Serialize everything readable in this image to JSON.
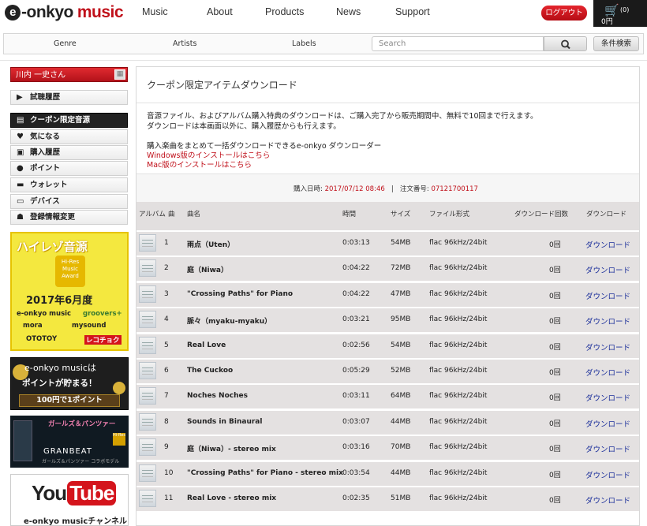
{
  "header": {
    "logo_prefix": "e",
    "logo_onkyo": "-onkyo",
    "logo_music": "music",
    "nav": [
      "Music",
      "About",
      "Products",
      "News",
      "Support"
    ],
    "logout_label": "ログアウト",
    "cart_count": "(0)",
    "cart_total": "0円"
  },
  "searchbar": {
    "links": [
      "Genre",
      "Artists",
      "Labels"
    ],
    "placeholder": "Search",
    "advanced_label": "条件検索"
  },
  "sidebar": {
    "user_name": "川内 一史さん",
    "menu": [
      {
        "label": "試聴履歴",
        "icon": "play-icon",
        "active": false
      },
      {
        "label": "クーポン限定音源",
        "icon": "coupon-icon",
        "active": true
      },
      {
        "label": "気になる",
        "icon": "heart-icon",
        "active": false
      },
      {
        "label": "購入履歴",
        "icon": "receipt-icon",
        "active": false
      },
      {
        "label": "ポイント",
        "icon": "point-icon",
        "active": false
      },
      {
        "label": "ウォレット",
        "icon": "wallet-icon",
        "active": false
      },
      {
        "label": "デバイス",
        "icon": "device-icon",
        "active": false
      },
      {
        "label": "登録情報変更",
        "icon": "user-icon",
        "active": false
      }
    ],
    "banners": {
      "hires": {
        "title": "ハイレゾ音源",
        "badge": "Hi-Res Music Award",
        "month": "2017年6月度",
        "stores": [
          "e-onkyo music",
          "groovers+",
          "mora",
          "mysound",
          "OTOTOY",
          "レコチョク"
        ]
      },
      "point": {
        "line1": "e-onkyo musicは",
        "line2": "ポイントが貯まる！",
        "line3": "100円で1ポイント"
      },
      "granbeat": {
        "title": "ガールズ＆パンツァー",
        "brand": "GRANBEAT",
        "sub": "ガールズ＆パンツァー コラボモデル"
      },
      "youtube": {
        "you": "You",
        "tube": "Tube",
        "caption": "e-onkyo musicチャンネル"
      }
    }
  },
  "main": {
    "title": "クーポン限定アイテムダウンロード",
    "desc_line1": "音源ファイル、およびアルバム購入特典のダウンロードは、ご購入完了から販売期間中、無料で10回まで行えます。",
    "desc_line2": "ダウンロードは本画面以外に、購入履歴からも行えます。",
    "downloader_text": "購入楽曲をまとめて一括ダウンロードできるe-onkyo ダウンローダー",
    "windows_link": "Windows版のインストールはこちら",
    "mac_link": "Mac版のインストールはこちら",
    "purchase_label": "購入日時:",
    "purchase_date": "2017/07/12 08:46",
    "separator": "|",
    "order_label": "注文番号:",
    "order_no": "07121700117",
    "columns": [
      "アルバム",
      "曲",
      "曲名",
      "時間",
      "サイズ",
      "ファイル形式",
      "ダウンロード回数",
      "ダウンロード"
    ],
    "rows": [
      {
        "num": "1",
        "name": "雨点（Uten）",
        "time": "0:03:13",
        "size": "54MB",
        "format": "flac 96kHz/24bit",
        "count": "0回",
        "action": "ダウンロード"
      },
      {
        "num": "2",
        "name": "庭（Niwa）",
        "time": "0:04:22",
        "size": "72MB",
        "format": "flac 96kHz/24bit",
        "count": "0回",
        "action": "ダウンロード"
      },
      {
        "num": "3",
        "name": "\"Crossing Paths\" for Piano",
        "time": "0:04:22",
        "size": "47MB",
        "format": "flac 96kHz/24bit",
        "count": "0回",
        "action": "ダウンロード"
      },
      {
        "num": "4",
        "name": "脈々（myaku-myaku）",
        "time": "0:03:21",
        "size": "95MB",
        "format": "flac 96kHz/24bit",
        "count": "0回",
        "action": "ダウンロード"
      },
      {
        "num": "5",
        "name": "Real Love",
        "time": "0:02:56",
        "size": "54MB",
        "format": "flac 96kHz/24bit",
        "count": "0回",
        "action": "ダウンロード"
      },
      {
        "num": "6",
        "name": "The Cuckoo",
        "time": "0:05:29",
        "size": "52MB",
        "format": "flac 96kHz/24bit",
        "count": "0回",
        "action": "ダウンロード"
      },
      {
        "num": "7",
        "name": "Noches Noches",
        "time": "0:03:11",
        "size": "64MB",
        "format": "flac 96kHz/24bit",
        "count": "0回",
        "action": "ダウンロード"
      },
      {
        "num": "8",
        "name": "Sounds in Binaural",
        "time": "0:03:07",
        "size": "44MB",
        "format": "flac 96kHz/24bit",
        "count": "0回",
        "action": "ダウンロード"
      },
      {
        "num": "9",
        "name": "庭（Niwa）- stereo mix",
        "time": "0:03:16",
        "size": "70MB",
        "format": "flac 96kHz/24bit",
        "count": "0回",
        "action": "ダウンロード"
      },
      {
        "num": "10",
        "name": "\"Crossing Paths\" for Piano - stereo mix",
        "time": "0:03:54",
        "size": "44MB",
        "format": "flac 96kHz/24bit",
        "count": "0回",
        "action": "ダウンロード"
      },
      {
        "num": "11",
        "name": "Real Love - stereo mix",
        "time": "0:02:35",
        "size": "51MB",
        "format": "flac 96kHz/24bit",
        "count": "0回",
        "action": "ダウンロード"
      }
    ]
  },
  "colors": {
    "brand_red": "#c0101a",
    "link_blue": "#1a2e9a",
    "row_bg": "#e4e1e1"
  }
}
